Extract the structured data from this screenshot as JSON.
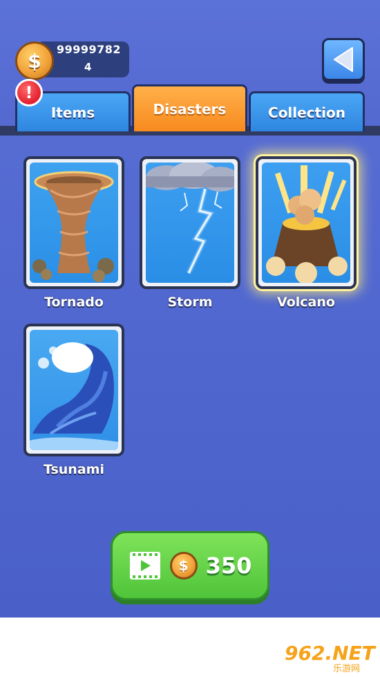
{
  "header": {
    "coins": "99999782",
    "gems": "4",
    "coin_symbol": "$",
    "alert_symbol": "!"
  },
  "tabs": [
    {
      "label": "Items",
      "active": false
    },
    {
      "label": "Disasters",
      "active": true
    },
    {
      "label": "Collection",
      "active": false
    }
  ],
  "cards": [
    {
      "label": "Tornado",
      "selected": false,
      "icon": "tornado"
    },
    {
      "label": "Storm",
      "selected": false,
      "icon": "lightning-storm"
    },
    {
      "label": "Volcano",
      "selected": true,
      "icon": "volcano"
    },
    {
      "label": "Tsunami",
      "selected": false,
      "icon": "tsunami-wave"
    }
  ],
  "buy_button": {
    "price": "350",
    "coin_symbol": "$",
    "icon": "video-ad"
  },
  "watermark": {
    "text": "962.NET",
    "sub": "乐游网"
  },
  "colors": {
    "background": "#5a70d6",
    "active_tab": "#f78a1e",
    "inactive_tab": "#2f86e0",
    "buy_button": "#4fc43a"
  }
}
